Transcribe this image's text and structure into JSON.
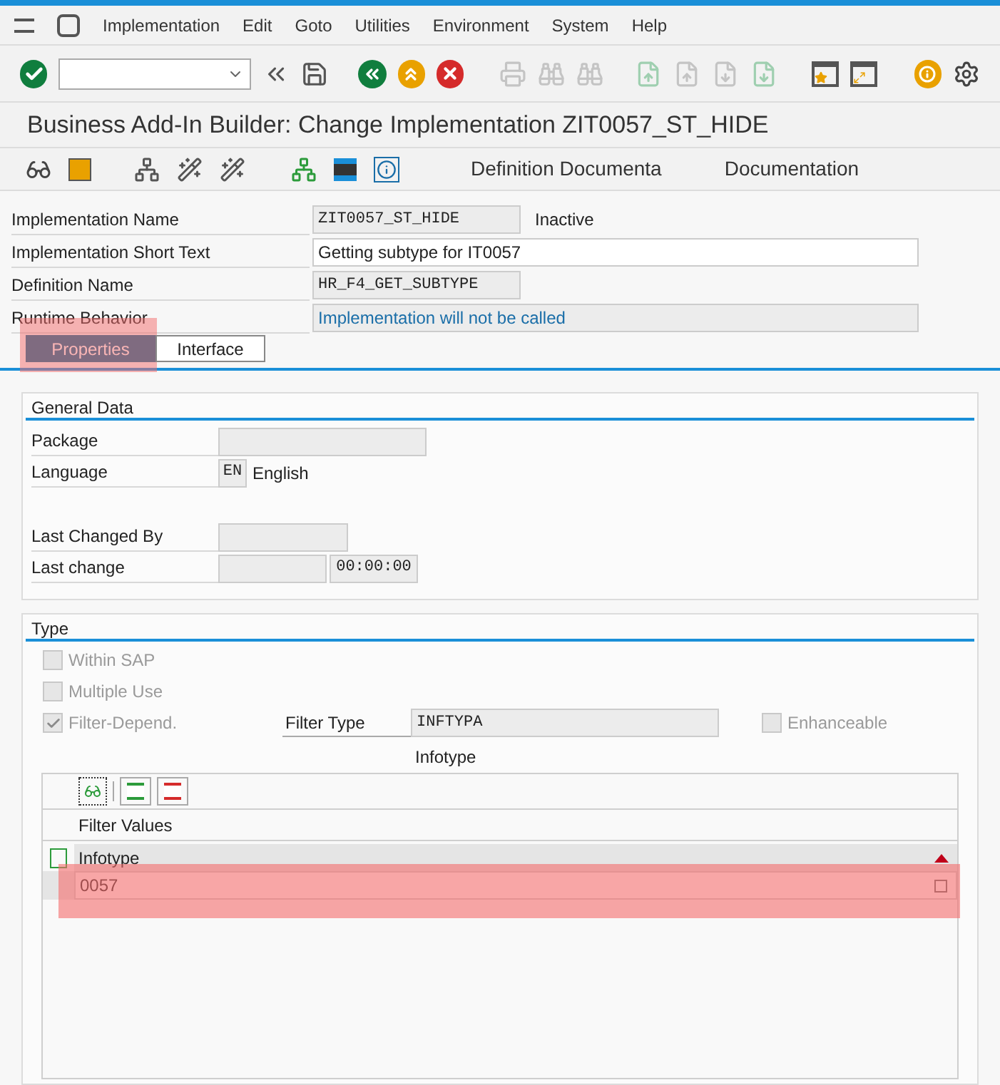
{
  "menu_bar": {
    "items": [
      "Implementation",
      "Edit",
      "Goto",
      "Utilities",
      "Environment",
      "System",
      "Help"
    ]
  },
  "title": "Business Add-In Builder: Change Implementation ZIT0057_ST_HIDE",
  "app_toolbar": {
    "buttons": [
      "Definition Documenta",
      "Documentation"
    ]
  },
  "header_fields": [
    {
      "label": "Implementation Name",
      "value": "ZIT0057_ST_HIDE",
      "kind": "readonly",
      "note": "Inactive"
    },
    {
      "label": "Implementation Short Text",
      "value": "Getting subtype for IT0057",
      "kind": "input"
    },
    {
      "label": "Definition Name",
      "value": "HR_F4_GET_SUBTYPE",
      "kind": "readonly"
    },
    {
      "label": "Runtime Behavior",
      "value": "Implementation will not be called",
      "kind": "info"
    }
  ],
  "tabs": [
    {
      "label": "Properties",
      "selected": true,
      "highlighted": true
    },
    {
      "label": "Interface",
      "selected": false,
      "highlighted": false
    }
  ],
  "general_data": {
    "title": "General Data",
    "fields": [
      {
        "label": "Package",
        "kind": "wide"
      },
      {
        "label": "Language",
        "kind": "language",
        "value": "EN",
        "description": "English"
      },
      {
        "label": "Last Changed By",
        "kind": "narrow"
      },
      {
        "label": "Last change",
        "kind": "datetime",
        "time": "00:00:00"
      }
    ]
  },
  "type": {
    "title": "Type",
    "checkboxes": [
      {
        "label": "Within SAP",
        "checked": false,
        "disabled": true
      },
      {
        "label": "Multiple Use",
        "checked": false,
        "disabled": true
      },
      {
        "label": "Filter-Depend.",
        "checked": true,
        "disabled": true
      }
    ],
    "filter_type": {
      "label": "Filter Type",
      "value": "INFTYPA",
      "description": "Infotype"
    },
    "enhanceable": {
      "label": "Enhanceable",
      "checked": false,
      "disabled": true
    },
    "table": {
      "title": "Filter Values",
      "columns": [
        "Infotype"
      ],
      "rows": [
        {
          "cells": [
            "0057"
          ],
          "highlighted": true
        }
      ]
    }
  }
}
